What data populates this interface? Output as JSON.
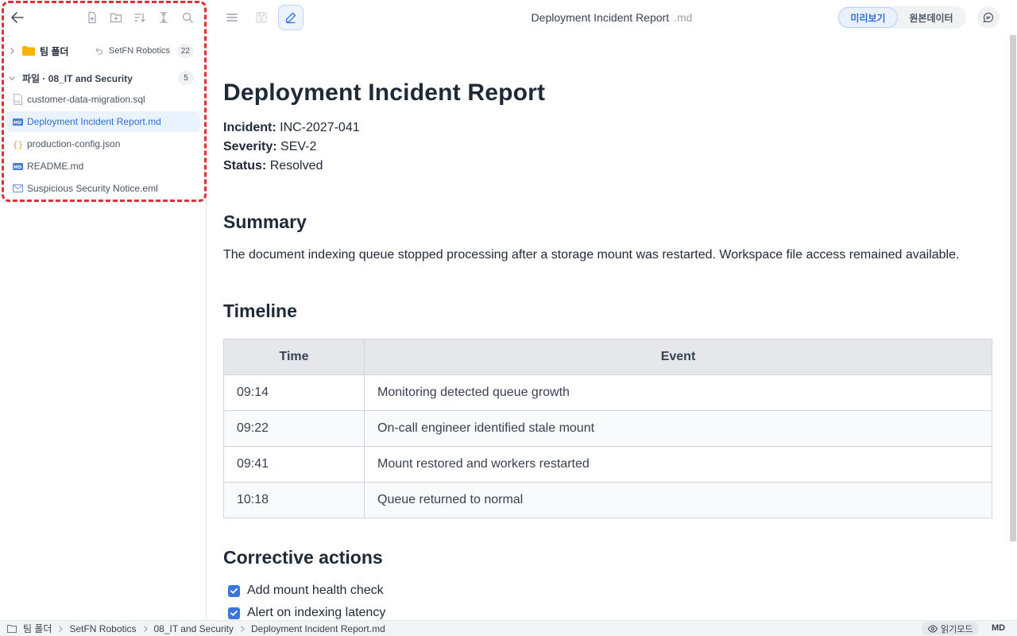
{
  "sidebar": {
    "team": {
      "label": "팀 폴더",
      "org": "SetFN Robotics",
      "count": "22"
    },
    "files_section": {
      "label": "파일 · 08_IT and Security",
      "count": "5"
    },
    "files": [
      {
        "name": "customer-data-migration.sql",
        "icon": "sql-file-icon",
        "active": false
      },
      {
        "name": "Deployment Incident Report.md",
        "icon": "markdown-file-icon",
        "active": true
      },
      {
        "name": "production-config.json",
        "icon": "json-file-icon",
        "active": false
      },
      {
        "name": "README.md",
        "icon": "markdown-file-icon",
        "active": false
      },
      {
        "name": "Suspicious Security Notice.eml",
        "icon": "email-file-icon",
        "active": false
      }
    ]
  },
  "topbar": {
    "doc_title": "Deployment Incident Report",
    "doc_ext": ".md",
    "preview_label": "미리보기",
    "raw_label": "원본데이터"
  },
  "doc": {
    "title": "Deployment Incident Report",
    "meta": [
      {
        "key": "Incident:",
        "value": "INC-2027-041"
      },
      {
        "key": "Severity:",
        "value": "SEV-2"
      },
      {
        "key": "Status:",
        "value": "Resolved"
      }
    ],
    "summary_heading": "Summary",
    "summary_text": "The document indexing queue stopped processing after a storage mount was restarted. Workspace file access remained available.",
    "timeline_heading": "Timeline",
    "timeline_headers": [
      "Time",
      "Event"
    ],
    "timeline_rows": [
      [
        "09:14",
        "Monitoring detected queue growth"
      ],
      [
        "09:22",
        "On-call engineer identified stale mount"
      ],
      [
        "09:41",
        "Mount restored and workers restarted"
      ],
      [
        "10:18",
        "Queue returned to normal"
      ]
    ],
    "actions_heading": "Corrective actions",
    "actions": [
      {
        "label": "Add mount health check",
        "checked": true
      },
      {
        "label": "Alert on indexing latency",
        "checked": true
      }
    ]
  },
  "statusbar": {
    "crumbs": [
      "팀 폴더",
      "SetFN Robotics",
      "08_IT and Security",
      "Deployment Incident Report.md"
    ],
    "read_mode": "읽기모드",
    "format": "MD"
  },
  "colors": {
    "accent": "#2f6fd6",
    "highlight_border": "#e03137",
    "folder": "#f5b400"
  }
}
